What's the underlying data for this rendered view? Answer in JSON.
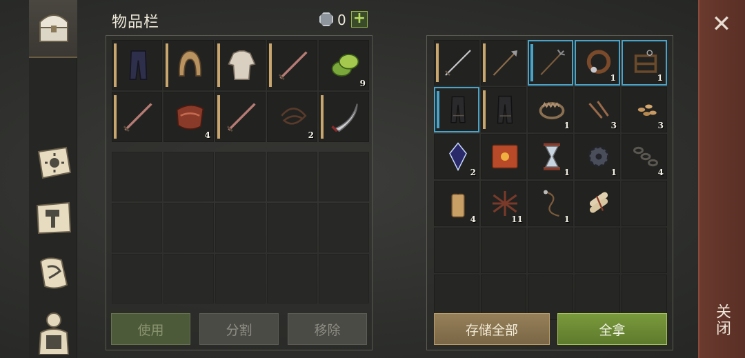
{
  "title": "物品栏",
  "currency": {
    "icon": "gem-coin-icon",
    "count": "0",
    "add_label": "+"
  },
  "nav": [
    {
      "name": "chest-icon",
      "active": true
    },
    {
      "name": "sun-book-icon"
    },
    {
      "name": "hammer-map-icon"
    },
    {
      "name": "scroll-quill-icon"
    },
    {
      "name": "character-icon"
    }
  ],
  "inventory": {
    "items": [
      {
        "name": "pants-icon",
        "count": ""
      },
      {
        "name": "hood-icon",
        "count": ""
      },
      {
        "name": "shirt-icon",
        "count": ""
      },
      {
        "name": "sword-icon",
        "count": ""
      },
      {
        "name": "green-pepper-icon",
        "count": "9"
      },
      {
        "name": "sword-icon",
        "count": ""
      },
      {
        "name": "meat-strips-icon",
        "count": "4"
      },
      {
        "name": "sword-icon",
        "count": ""
      },
      {
        "name": "rope-icon",
        "count": "2"
      },
      {
        "name": "scimitar-icon",
        "count": ""
      }
    ],
    "buttons": {
      "use": "使用",
      "split": "分割",
      "remove": "移除"
    }
  },
  "storage": {
    "items": [
      {
        "name": "long-sword-icon",
        "count": ""
      },
      {
        "name": "halberd-icon",
        "count": ""
      },
      {
        "name": "trident-icon",
        "count": ""
      },
      {
        "name": "collar-icon",
        "count": "1"
      },
      {
        "name": "wood-frame-icon",
        "count": "1"
      },
      {
        "name": "dark-pants-icon",
        "count": ""
      },
      {
        "name": "dark-pants-icon",
        "count": ""
      },
      {
        "name": "bear-trap-icon",
        "count": "1"
      },
      {
        "name": "nails-icon",
        "count": "3"
      },
      {
        "name": "seeds-icon",
        "count": "3"
      },
      {
        "name": "crystal-icon",
        "count": "2"
      },
      {
        "name": "sun-book-icon",
        "count": ""
      },
      {
        "name": "hourglass-icon",
        "count": "1"
      },
      {
        "name": "gear-icon",
        "count": "1"
      },
      {
        "name": "chain-icon",
        "count": "4"
      },
      {
        "name": "candle-icon",
        "count": "4"
      },
      {
        "name": "twig-net-icon",
        "count": "11"
      },
      {
        "name": "leash-icon",
        "count": "1"
      },
      {
        "name": "scroll-bundle-icon",
        "count": ""
      }
    ],
    "buttons": {
      "store_all": "存储全部",
      "take_all": "全拿"
    }
  },
  "close": {
    "label": "关闭",
    "icon": "close-icon"
  }
}
